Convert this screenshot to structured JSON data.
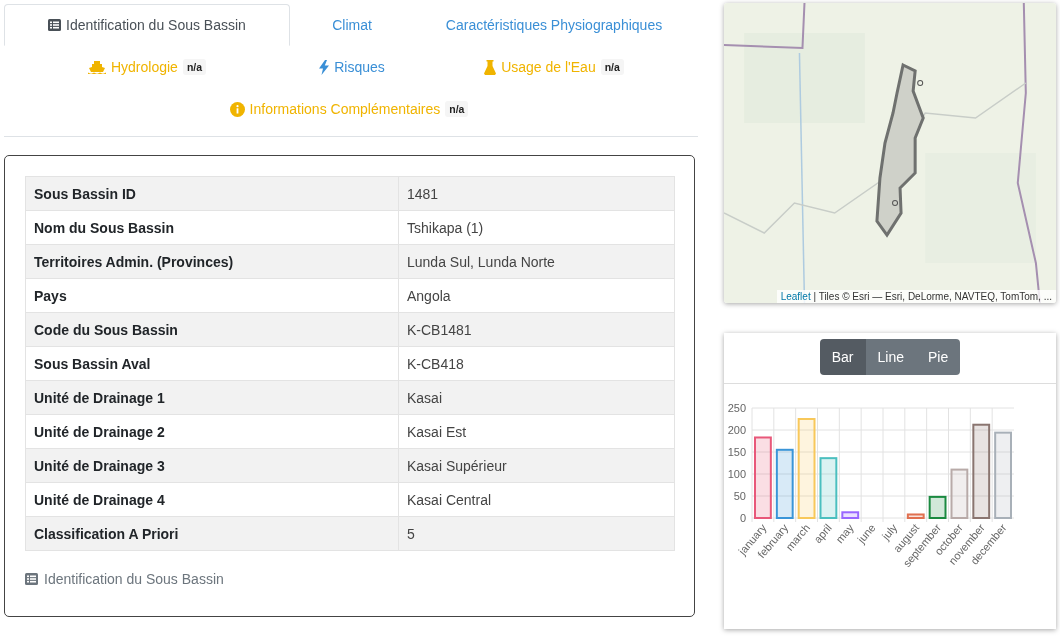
{
  "tabs": [
    {
      "label": "Identification du Sous Bassin",
      "kind": "list",
      "selected": true,
      "color": "#495057"
    },
    {
      "label": "Climat",
      "kind": "none",
      "selected": false,
      "color": "#3a8fd6"
    },
    {
      "label": "Caractéristiques Physiographiques",
      "kind": "none",
      "selected": false,
      "color": "#3a8fd6"
    },
    {
      "label": "Hydrologie",
      "kind": "boat",
      "selected": false,
      "color": "#f0b400",
      "badge": "n/a"
    },
    {
      "label": "Risques",
      "kind": "bolt",
      "selected": false,
      "color": "#3a8fd6"
    },
    {
      "label": "Usage de l'Eau",
      "kind": "flask",
      "selected": false,
      "color": "#f0b400",
      "badge": "n/a"
    },
    {
      "label": "Informations Complémentaires",
      "kind": "info",
      "selected": false,
      "color": "#f0b400",
      "badge": "n/a"
    }
  ],
  "table": {
    "rows": [
      {
        "label": "Sous Bassin ID",
        "value": "1481"
      },
      {
        "label": "Nom du Sous Bassin",
        "value": "Tshikapa (1)"
      },
      {
        "label": "Territoires Admin. (Provinces)",
        "value": "Lunda Sul, Lunda Norte"
      },
      {
        "label": "Pays",
        "value": "Angola"
      },
      {
        "label": "Code du Sous Bassin",
        "value": "K-CB1481"
      },
      {
        "label": "Sous Bassin Aval",
        "value": "K-CB418"
      },
      {
        "label": "Unité de Drainage 1",
        "value": "Kasai"
      },
      {
        "label": "Unité de Drainage 2",
        "value": "Kasai Est"
      },
      {
        "label": "Unité de Drainage 3",
        "value": "Kasai Supérieur"
      },
      {
        "label": "Unité de Drainage 4",
        "value": "Kasai Central"
      },
      {
        "label": "Classification A Priori",
        "value": "5"
      }
    ],
    "caption": "Identification du Sous Bassin"
  },
  "map": {
    "kind": "picture",
    "attribution_link": "Leaflet",
    "attribution": "| Tiles © Esri — Esri, DeLorme, NAVTEQ, TomTom, ..."
  },
  "chart_buttons": [
    {
      "label": "Bar",
      "selected": true
    },
    {
      "label": "Line",
      "selected": false
    },
    {
      "label": "Pie",
      "selected": false
    }
  ],
  "chart": {
    "chart_data": {
      "type": "bar",
      "categories": [
        "january",
        "february",
        "march",
        "april",
        "may",
        "june",
        "july",
        "august",
        "september",
        "october",
        "november",
        "december"
      ],
      "series": [
        {
          "values": [
            183,
            155,
            225,
            136,
            13,
            0,
            0,
            8,
            48,
            110,
            212,
            194
          ]
        }
      ],
      "colors": [
        "#e8587a",
        "#3a95d8",
        "#f8c85a",
        "#4bbfbf",
        "#9966ff",
        null,
        null,
        "#e07050",
        "#1a8a40",
        "#b8aaa8",
        "#8a7570",
        "#a8b0b8"
      ],
      "grid": true,
      "ylim": [
        0,
        250
      ],
      "yticks": [
        0,
        50,
        100,
        150,
        200,
        250
      ]
    }
  }
}
